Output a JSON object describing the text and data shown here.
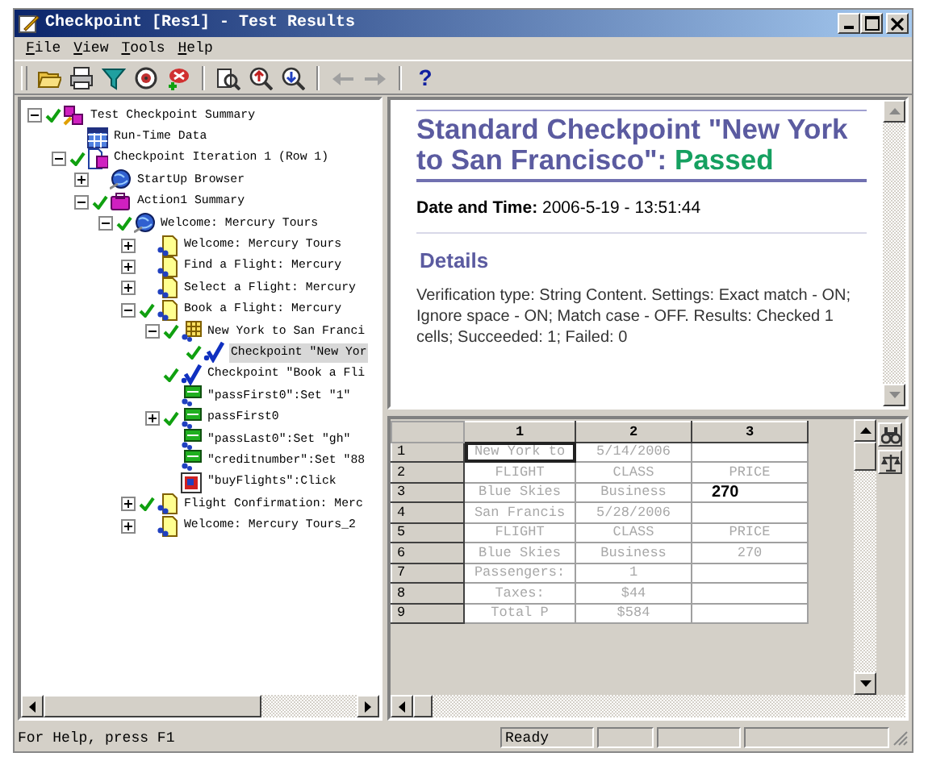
{
  "window": {
    "title": "Checkpoint [Res1] - Test Results"
  },
  "menu": [
    {
      "label": "File"
    },
    {
      "label": "View"
    },
    {
      "label": "Tools"
    },
    {
      "label": "Help"
    }
  ],
  "toolbar": [
    {
      "kind": "open"
    },
    {
      "kind": "print"
    },
    {
      "kind": "filter"
    },
    {
      "kind": "target"
    },
    {
      "kind": "add-defect"
    },
    {
      "kind": "separator"
    },
    {
      "kind": "find"
    },
    {
      "kind": "zoom-in"
    },
    {
      "kind": "zoom-out"
    },
    {
      "kind": "separator"
    },
    {
      "kind": "back",
      "disabled": true
    },
    {
      "kind": "forward",
      "disabled": true
    },
    {
      "kind": "separator"
    },
    {
      "kind": "help",
      "label": "?"
    }
  ],
  "tree": [
    {
      "label": "Test Checkpoint Summary",
      "kind": "summary",
      "passed": true,
      "expanded": true,
      "selected": false,
      "children": [
        {
          "label": "Run-Time Data",
          "kind": "data",
          "passed": false,
          "selected": false
        },
        {
          "label": "Checkpoint Iteration 1 (Row 1)",
          "kind": "iteration",
          "passed": true,
          "expanded": true,
          "selected": false,
          "children": [
            {
              "label": "StartUp Browser",
              "kind": "browser",
              "passed": false,
              "expanded": false,
              "selected": false
            },
            {
              "label": "Action1 Summary",
              "kind": "action",
              "passed": true,
              "expanded": true,
              "selected": false,
              "children": [
                {
                  "label": "Welcome: Mercury Tours",
                  "kind": "browser",
                  "passed": true,
                  "expanded": true,
                  "selected": false,
                  "children": [
                    {
                      "label": "Welcome: Mercury Tours",
                      "kind": "page",
                      "passed": false,
                      "expanded": false,
                      "selected": false
                    },
                    {
                      "label": "Find a Flight: Mercury",
                      "kind": "page",
                      "passed": false,
                      "expanded": false,
                      "selected": false
                    },
                    {
                      "label": "Select a Flight: Mercury",
                      "kind": "page",
                      "passed": false,
                      "expanded": false,
                      "selected": false
                    },
                    {
                      "label": "Book a Flight: Mercury",
                      "kind": "page",
                      "passed": true,
                      "expanded": true,
                      "selected": false,
                      "children": [
                        {
                          "label": "New York to San Franci",
                          "kind": "table",
                          "passed": true,
                          "expanded": true,
                          "selected": false,
                          "children": [
                            {
                              "label": "Checkpoint \"New Yor",
                              "kind": "checkpoint",
                              "passed": true,
                              "selected": true
                            }
                          ]
                        },
                        {
                          "label": "Checkpoint \"Book a Fli",
                          "kind": "checkpoint",
                          "passed": true,
                          "selected": false
                        },
                        {
                          "label": "\"passFirst0\":Set \"1\"",
                          "kind": "edit",
                          "passed": false,
                          "selected": false
                        },
                        {
                          "label": "passFirst0",
                          "kind": "edit",
                          "passed": true,
                          "expanded": false,
                          "selected": false
                        },
                        {
                          "label": "\"passLast0\":Set \"gh\"",
                          "kind": "edit",
                          "passed": false,
                          "selected": false
                        },
                        {
                          "label": "\"creditnumber\":Set \"88",
                          "kind": "edit",
                          "passed": false,
                          "selected": false
                        },
                        {
                          "label": "\"buyFlights\":Click",
                          "kind": "image",
                          "passed": false,
                          "selected": false
                        }
                      ]
                    },
                    {
                      "label": "Flight Confirmation: Merc",
                      "kind": "page",
                      "passed": true,
                      "expanded": false,
                      "selected": false
                    },
                    {
                      "label": "Welcome: Mercury Tours_2",
                      "kind": "page",
                      "passed": false,
                      "expanded": false,
                      "selected": false
                    }
                  ]
                }
              ]
            }
          ]
        }
      ]
    }
  ],
  "report": {
    "title": "Standard Checkpoint \"New York to San Francisco\":",
    "result": "Passed",
    "date": "**Date and Time:** 2006-5-19 - 13:51:44",
    "details_heading": "Details",
    "details": "Verification type: String Content. Settings: Exact match - ON; Ignore space - ON; Match case - OFF. Results: Checked 1 cells; Succeeded: 1; Failed: 0"
  },
  "grid": {
    "columns": [
      "1",
      "2",
      "3"
    ],
    "rows": [
      {
        "label": "1",
        "cells": [
          {
            "text": "New York to",
            "selected": true,
            "checked": false
          },
          {
            "text": "5/14/2006",
            "selected": false,
            "checked": false
          },
          {
            "selected": false,
            "checked": false
          }
        ]
      },
      {
        "label": "2",
        "cells": [
          {
            "text": "FLIGHT",
            "selected": false,
            "checked": false
          },
          {
            "text": "CLASS",
            "selected": false,
            "checked": false
          },
          {
            "text": "PRICE",
            "selected": false,
            "checked": false
          }
        ]
      },
      {
        "label": "3",
        "cells": [
          {
            "text": "Blue Skies",
            "selected": false,
            "checked": false
          },
          {
            "text": "Business",
            "selected": false,
            "checked": false
          },
          {
            "text": "270",
            "selected": false,
            "checked": true
          }
        ]
      },
      {
        "label": "4",
        "cells": [
          {
            "text": "San Francis",
            "selected": false,
            "checked": false
          },
          {
            "text": "5/28/2006",
            "selected": false,
            "checked": false
          },
          {
            "selected": false,
            "checked": false
          }
        ]
      },
      {
        "label": "5",
        "cells": [
          {
            "text": "FLIGHT",
            "selected": false,
            "checked": false
          },
          {
            "text": "CLASS",
            "selected": false,
            "checked": false
          },
          {
            "text": "PRICE",
            "selected": false,
            "checked": false
          }
        ]
      },
      {
        "label": "6",
        "cells": [
          {
            "text": "Blue Skies",
            "selected": false,
            "checked": false
          },
          {
            "text": "Business",
            "selected": false,
            "checked": false
          },
          {
            "text": "270",
            "selected": false,
            "checked": false
          }
        ]
      },
      {
        "label": "7",
        "cells": [
          {
            "text": "Passengers:",
            "selected": false,
            "checked": false
          },
          {
            "text": "1",
            "selected": false,
            "checked": false
          },
          {
            "selected": false,
            "checked": false
          }
        ]
      },
      {
        "label": "8",
        "cells": [
          {
            "text": "Taxes:",
            "selected": false,
            "checked": false
          },
          {
            "text": "$44",
            "selected": false,
            "checked": false
          },
          {
            "selected": false,
            "checked": false
          }
        ]
      },
      {
        "label": "9",
        "cells": [
          {
            "text": "Total P",
            "selected": false,
            "checked": false
          },
          {
            "text": "$584",
            "selected": false,
            "checked": false
          },
          {
            "selected": false,
            "checked": false
          }
        ]
      }
    ]
  },
  "status_bar": {
    "help": "For Help, press F1",
    "state": "Ready"
  }
}
